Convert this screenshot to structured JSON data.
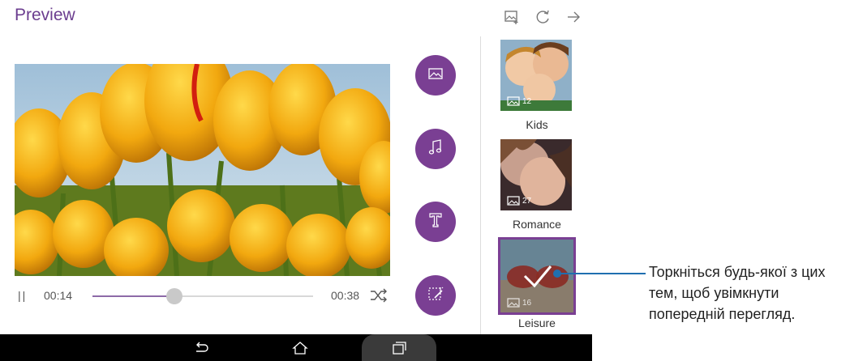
{
  "header": {
    "title": "Preview",
    "icons": [
      "add-photo-icon",
      "refresh-icon",
      "arrow-right-icon"
    ]
  },
  "player": {
    "pause_glyph": "||",
    "current_time": "00:14",
    "total_time": "00:38",
    "progress": 0.37
  },
  "side_buttons": [
    "image-icon",
    "music-icon",
    "text-icon",
    "effects-icon"
  ],
  "themes": [
    {
      "name": "Kids",
      "count": "12",
      "selected": false
    },
    {
      "name": "Romance",
      "count": "27",
      "selected": false
    },
    {
      "name": "Leisure",
      "count": "16",
      "selected": true
    }
  ],
  "nav": [
    "back-icon",
    "home-icon",
    "recents-icon"
  ],
  "callout": {
    "text": "Торкніться будь-якої з цих тем, щоб увімкнути попередній перегляд."
  },
  "colors": {
    "accent": "#7a3f93",
    "callout": "#1f6fb0",
    "navbar": "#000000"
  }
}
